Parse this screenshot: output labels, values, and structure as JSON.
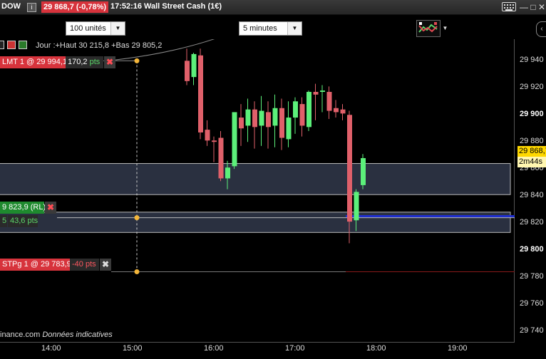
{
  "titlebar": {
    "symbol": "DOW",
    "info_icon": "i",
    "price": "29 868,7 (-0,78%)",
    "time": "17:52:16",
    "market": "Wall Street Cash (1€)",
    "window_buttons": [
      "—",
      "□",
      "✕"
    ]
  },
  "toolbar": {
    "units": "100 unités",
    "period": "5 minutes",
    "side_arrow": "‹"
  },
  "chart": {
    "day_info": "Jour :+Haut 30 215,8 +Bas 29 805,2",
    "y_ticks": [
      {
        "label": "29 940",
        "major": false
      },
      {
        "label": "29 920",
        "major": false
      },
      {
        "label": "29 900",
        "major": true
      },
      {
        "label": "29 880",
        "major": false
      },
      {
        "label": "29 860",
        "major": false
      },
      {
        "label": "29 840",
        "major": false
      },
      {
        "label": "29 820",
        "major": false
      },
      {
        "label": "29 800",
        "major": true
      },
      {
        "label": "29 780",
        "major": false
      },
      {
        "label": "29 760",
        "major": false
      },
      {
        "label": "29 740",
        "major": false
      }
    ],
    "x_ticks": [
      "14:00",
      "15:00",
      "16:00",
      "17:00",
      "18:00",
      "19:00"
    ],
    "current_price": "29 868,7",
    "timer": "2m44s",
    "footer_site": "inance.com",
    "footer_note": "Données indicatives",
    "colors": {
      "up": "#5cf07a",
      "down": "#e0606a",
      "zone": "#2a3040",
      "blue_line": "#1f2fd0"
    }
  },
  "orders": {
    "lmt": {
      "label": "LMT  1 @ 29 994,1",
      "pts": "170,2",
      "pts_unit": "pts"
    },
    "stop_rl": {
      "label": "9 823,9",
      "suffix": "(RL)",
      "left_val": "5",
      "pts": "43,6",
      "pts_unit": "pts"
    },
    "stp": {
      "label": "STPg  1 @ 29 783,9",
      "pts": "-40",
      "pts_unit": "pts"
    }
  },
  "chart_data": {
    "type": "candlestick",
    "candles": [
      {
        "x": "15:40",
        "o": 29940,
        "h": 29949,
        "c": 29925,
        "l": 29922
      },
      {
        "x": "15:45",
        "o": 29928,
        "h": 29946,
        "c": 29945,
        "l": 29922
      },
      {
        "x": "15:50",
        "o": 29944,
        "h": 29949,
        "c": 29887,
        "l": 29882
      },
      {
        "x": "15:55",
        "o": 29889,
        "h": 29896,
        "c": 29881,
        "l": 29877
      },
      {
        "x": "16:00",
        "o": 29881,
        "h": 29884,
        "c": 29880,
        "l": 29865
      },
      {
        "x": "16:05",
        "o": 29883,
        "h": 29888,
        "c": 29853,
        "l": 29851
      },
      {
        "x": "16:10",
        "o": 29853,
        "h": 29866,
        "c": 29861,
        "l": 29845
      },
      {
        "x": "16:15",
        "o": 29862,
        "h": 29898,
        "c": 29902,
        "l": 29860
      },
      {
        "x": "16:20",
        "o": 29898,
        "h": 29908,
        "c": 29890,
        "l": 29877
      },
      {
        "x": "16:25",
        "o": 29892,
        "h": 29912,
        "c": 29904,
        "l": 29880
      },
      {
        "x": "16:30",
        "o": 29904,
        "h": 29910,
        "c": 29891,
        "l": 29875
      },
      {
        "x": "16:35",
        "o": 29892,
        "h": 29914,
        "c": 29903,
        "l": 29877
      },
      {
        "x": "16:40",
        "o": 29902,
        "h": 29910,
        "c": 29891,
        "l": 29875
      },
      {
        "x": "16:45",
        "o": 29892,
        "h": 29915,
        "c": 29905,
        "l": 29876
      },
      {
        "x": "16:50",
        "o": 29905,
        "h": 29912,
        "c": 29883,
        "l": 29874
      },
      {
        "x": "16:55",
        "o": 29882,
        "h": 29910,
        "c": 29898,
        "l": 29876
      },
      {
        "x": "17:00",
        "o": 29898,
        "h": 29913,
        "c": 29910,
        "l": 29886
      },
      {
        "x": "17:05",
        "o": 29908,
        "h": 29913,
        "c": 29892,
        "l": 29884
      },
      {
        "x": "17:10",
        "o": 29891,
        "h": 29918,
        "c": 29917,
        "l": 29888
      },
      {
        "x": "17:15",
        "o": 29917,
        "h": 29923,
        "c": 29915,
        "l": 29896
      },
      {
        "x": "17:20",
        "o": 29917,
        "h": 29922,
        "c": 29918,
        "l": 29902
      },
      {
        "x": "17:25",
        "o": 29917,
        "h": 29921,
        "c": 29903,
        "l": 29897
      },
      {
        "x": "17:30",
        "o": 29905,
        "h": 29911,
        "c": 29902,
        "l": 29898
      },
      {
        "x": "17:35",
        "o": 29904,
        "h": 29908,
        "c": 29901,
        "l": 29896
      },
      {
        "x": "17:40",
        "o": 29900,
        "h": 29903,
        "c": 29821,
        "l": 29805
      },
      {
        "x": "17:45",
        "o": 29822,
        "h": 29845,
        "c": 29843,
        "l": 29814
      },
      {
        "x": "17:50",
        "o": 29848,
        "h": 29871,
        "c": 29868,
        "l": 29845
      }
    ],
    "ylim": [
      29732,
      29956
    ],
    "lines": {
      "lmt": 29994.1,
      "stop_rl": 29823.9,
      "stp": 29783.9
    },
    "zones": [
      [
        29841,
        29864
      ],
      [
        29813,
        29828
      ]
    ]
  }
}
